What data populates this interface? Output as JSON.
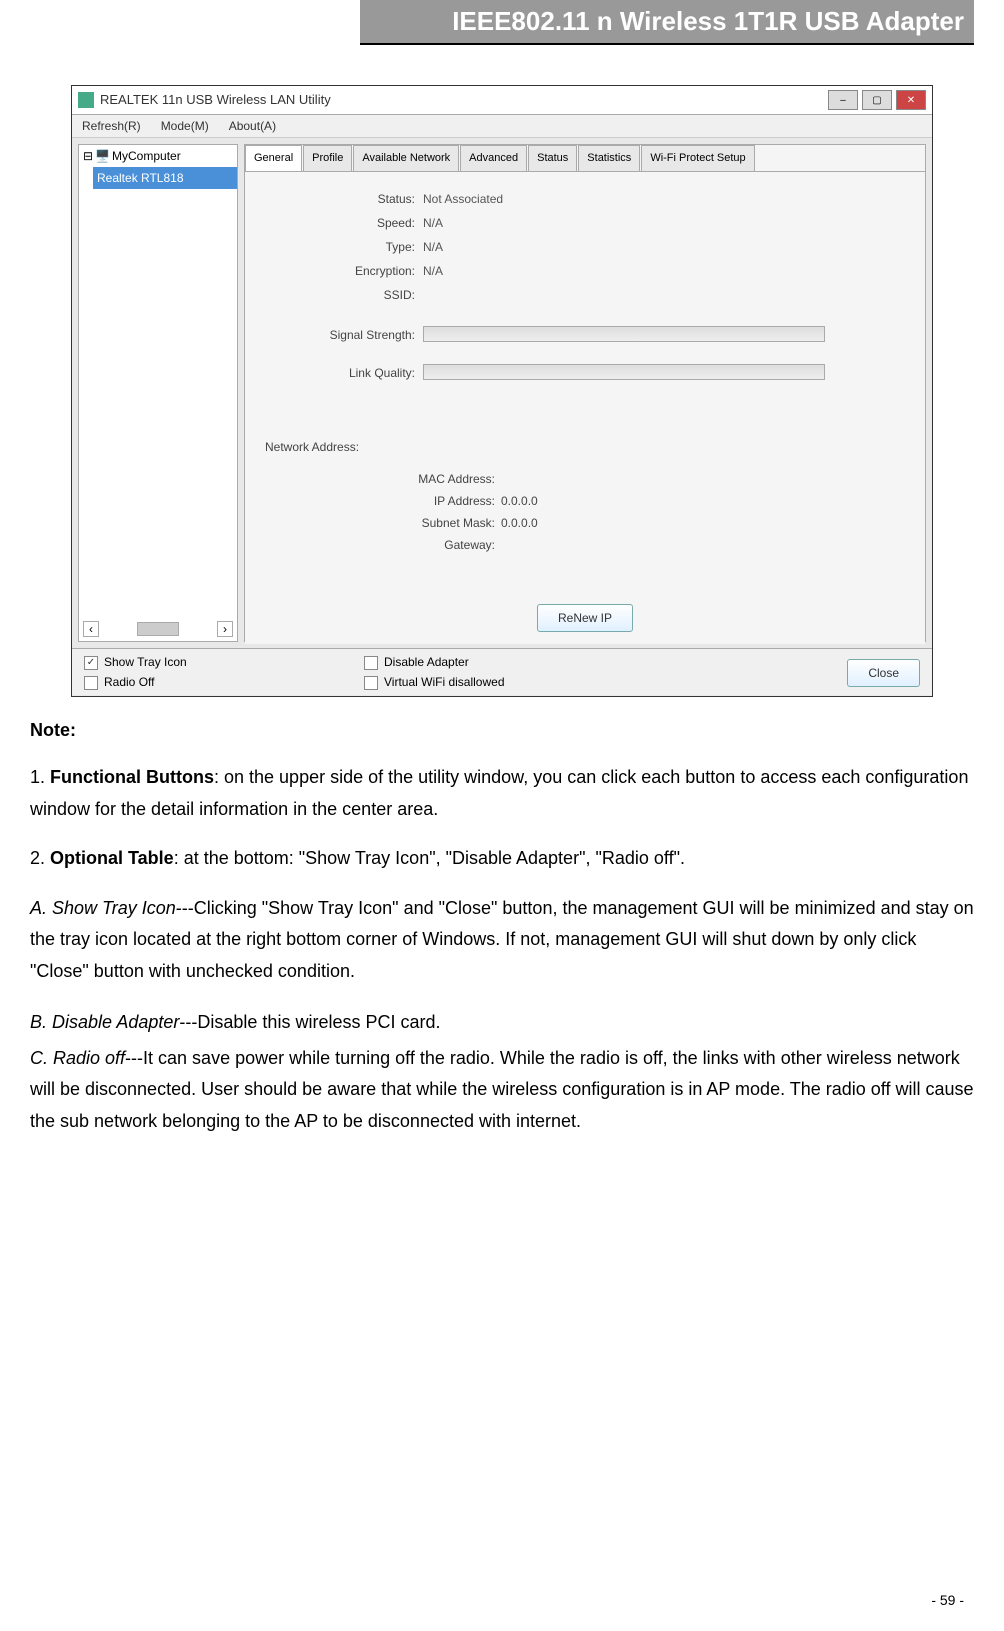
{
  "header": "IEEE802.11 n Wireless 1T1R USB Adapter",
  "window": {
    "title": "REALTEK 11n USB Wireless LAN Utility",
    "menu": [
      "Refresh(R)",
      "Mode(M)",
      "About(A)"
    ],
    "tree": {
      "root": "MyComputer",
      "child": "Realtek RTL818"
    },
    "tabs": [
      "General",
      "Profile",
      "Available Network",
      "Advanced",
      "Status",
      "Statistics",
      "Wi-Fi Protect Setup"
    ],
    "status": {
      "status_label": "Status:",
      "status_val": "Not Associated",
      "speed_label": "Speed:",
      "speed_val": "N/A",
      "type_label": "Type:",
      "type_val": "N/A",
      "enc_label": "Encryption:",
      "enc_val": "N/A",
      "ssid_label": "SSID:",
      "ssid_val": "",
      "signal_label": "Signal Strength:",
      "link_label": "Link Quality:"
    },
    "network_heading": "Network Address:",
    "network": {
      "mac_label": "MAC Address:",
      "mac_val": "",
      "ip_label": "IP Address:",
      "ip_val": "0.0.0.0",
      "mask_label": "Subnet Mask:",
      "mask_val": "0.0.0.0",
      "gw_label": "Gateway:",
      "gw_val": ""
    },
    "renew_btn": "ReNew IP",
    "opt_show_tray": "Show Tray Icon",
    "opt_radio_off": "Radio Off",
    "opt_disable": "Disable Adapter",
    "opt_virtual": "Virtual WiFi disallowed",
    "close_btn": "Close"
  },
  "text": {
    "note": "Note:",
    "p1_prefix": "1. ",
    "p1_bold": "Functional Buttons",
    "p1_rest": ": on the upper side of the utility window, you can click each button to access each configuration window for the detail information in the center area.",
    "p2_prefix": "2. ",
    "p2_bold": "Optional Table",
    "p2_rest": ": at the bottom: \"Show Tray Icon\", \"Disable Adapter\", \"Radio off\".",
    "pA_italic": "A. Show Tray Icon",
    "pA_rest": "---Clicking \"Show Tray Icon\" and \"Close\" button, the management GUI will be minimized and stay on the tray icon located at the right bottom corner of Windows. If not, management GUI will shut down by only click \"Close\" button with unchecked condition.",
    "pB_italic": "B. Disable Adapter",
    "pB_rest": "---Disable this wireless PCI card.",
    "pC_italic": "C. Radio off",
    "pC_rest": "---It can save power while turning off the radio. While the radio is off, the links with other wireless network will be disconnected. User should be aware that while the wireless configuration is in AP mode. The radio off will cause the sub network belonging to the AP to be disconnected with internet."
  },
  "page_number": "- 59 -"
}
